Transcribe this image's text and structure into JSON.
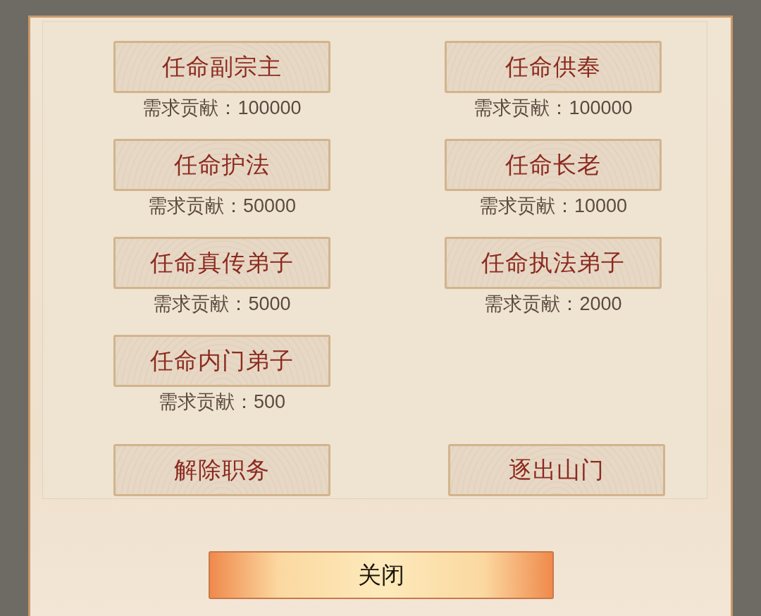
{
  "appointments": [
    {
      "label": "任命副宗主",
      "requirement": "需求贡献：100000"
    },
    {
      "label": "任命供奉",
      "requirement": "需求贡献：100000"
    },
    {
      "label": "任命护法",
      "requirement": "需求贡献：50000"
    },
    {
      "label": "任命长老",
      "requirement": "需求贡献：10000"
    },
    {
      "label": "任命真传弟子",
      "requirement": "需求贡献：5000"
    },
    {
      "label": "任命执法弟子",
      "requirement": "需求贡献：2000"
    },
    {
      "label": "任命内门弟子",
      "requirement": "需求贡献：500"
    }
  ],
  "actions": [
    {
      "label": "解除职务"
    },
    {
      "label": "逐出山门"
    }
  ],
  "close_button": {
    "label": "关闭"
  }
}
